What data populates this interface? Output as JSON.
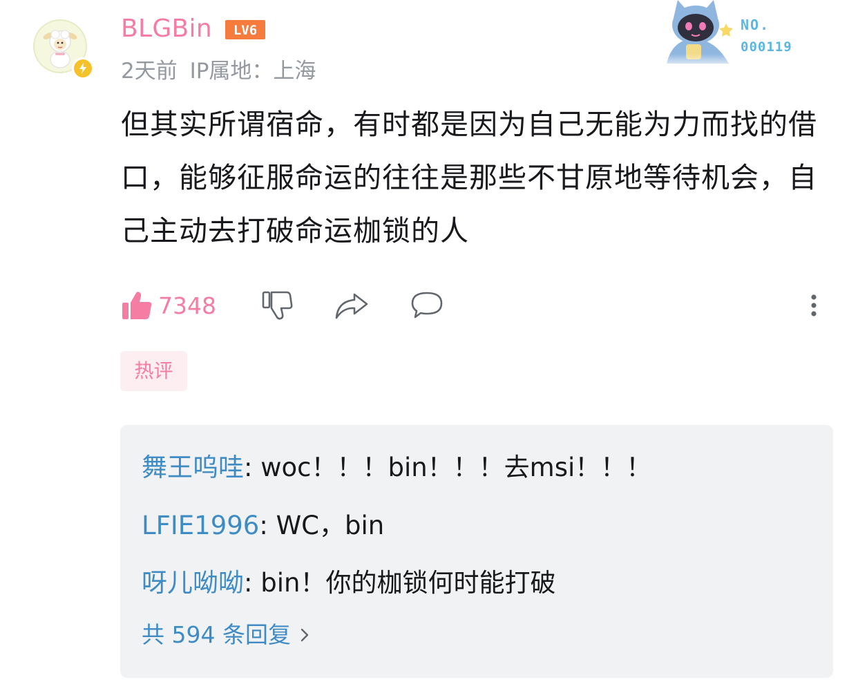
{
  "comment": {
    "username": "BLGBin",
    "level": "LV6",
    "time": "2天前",
    "ip_location": "IP属地：上海",
    "text": "但其实所谓宿命，有时都是因为自己无能为力而找的借口，能够征服命运的往往是那些不甘原地等待机会，自己主动去打破命运枷锁的人",
    "like_count": "7348",
    "tag": "热评"
  },
  "fan_badge": {
    "label": "NO.",
    "number": "000119"
  },
  "replies": {
    "items": [
      {
        "author": "舞王呜哇",
        "text": ": woc！！！bin！！！去msi！！！"
      },
      {
        "author": "LFIE1996",
        "text": ": WC，bin"
      },
      {
        "author": "呀儿呦呦",
        "text": ": bin！你的枷锁何时能打破"
      }
    ],
    "more_label": "共 594 条回复"
  },
  "colors": {
    "username": "#f57ca3",
    "reply_author": "#3f8cc5",
    "meta": "#9499a0",
    "replies_bg": "#f1f2f3"
  }
}
